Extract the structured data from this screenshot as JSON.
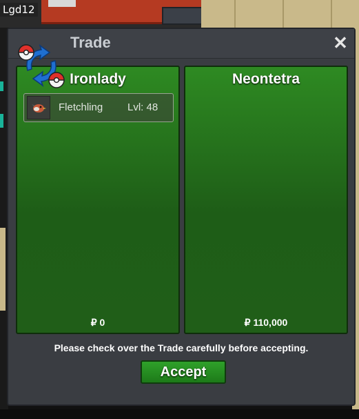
{
  "player_tag": "Lgd12",
  "window": {
    "title": "Trade",
    "close_glyph": "✕"
  },
  "left": {
    "name": "Ironlady",
    "items": [
      {
        "icon": "fletchling-icon",
        "name": "Fletchling",
        "level": "Lvl: 48"
      }
    ],
    "money": "₽ 0"
  },
  "right": {
    "name": "Neontetra",
    "items": [],
    "money": "₽ 110,000"
  },
  "notice": "Please check over the Trade carefully before accepting.",
  "accept_label": "Accept",
  "colors": {
    "panel_green": "#2e8a22",
    "window_bg": "#3a3d42",
    "accept_green": "#2fa12a",
    "logo_blue": "#1f6fd1",
    "logo_red": "#e0302b"
  }
}
